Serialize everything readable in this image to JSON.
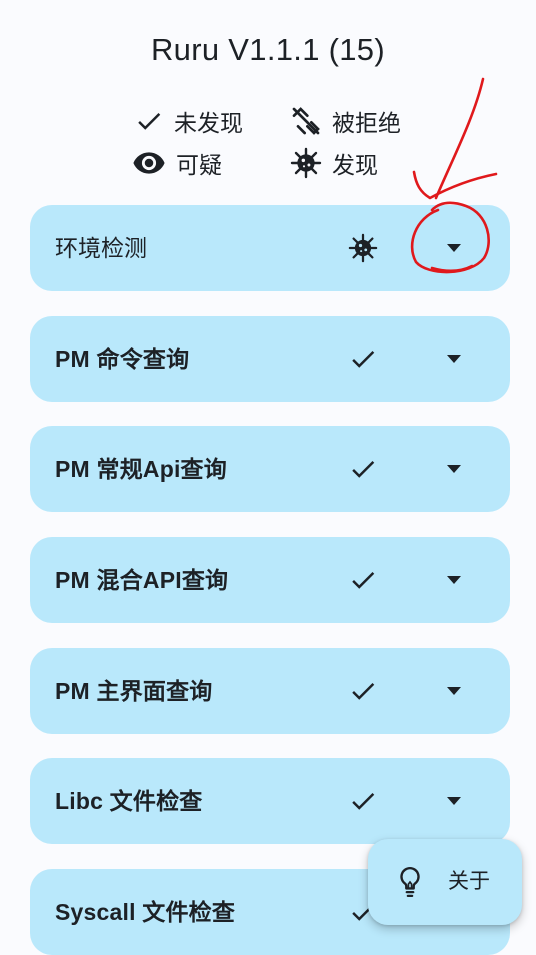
{
  "header": {
    "title": "Ruru V1.1.1 (15)"
  },
  "legend": {
    "not_found": {
      "label": "未发现",
      "icon": "check-icon"
    },
    "denied": {
      "label": "被拒绝",
      "icon": "link-off-icon"
    },
    "suspicious": {
      "label": "可疑",
      "icon": "eye-icon"
    },
    "found": {
      "label": "发现",
      "icon": "virus-icon"
    }
  },
  "checks": [
    {
      "label": "环境检测",
      "status": "found"
    },
    {
      "label": "PM 命令查询",
      "status": "not_found"
    },
    {
      "label": "PM 常规Api查询",
      "status": "not_found"
    },
    {
      "label": "PM 混合API查询",
      "status": "not_found"
    },
    {
      "label": "PM 主界面查询",
      "status": "not_found"
    },
    {
      "label": "Libc 文件检查",
      "status": "not_found"
    },
    {
      "label": "Syscall 文件检查",
      "status": "not_found"
    }
  ],
  "fab": {
    "label": "关于",
    "icon": "lightbulb-icon"
  },
  "colors": {
    "card": "#b9e8fb",
    "background": "#fafbfe",
    "text": "#1d2126",
    "annotation": "#e0191c"
  }
}
